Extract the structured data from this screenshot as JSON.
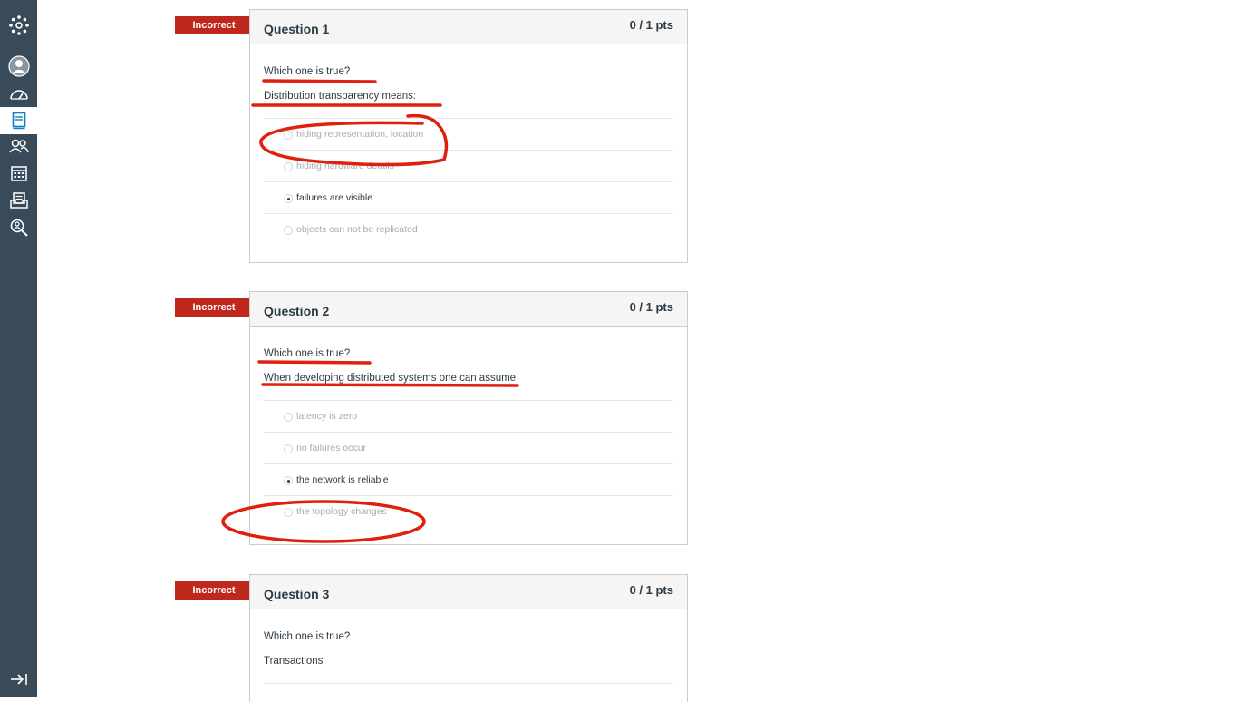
{
  "nav": {
    "items": [
      {
        "name": "canvas-logo-icon"
      },
      {
        "name": "account-icon"
      },
      {
        "name": "dashboard-icon"
      },
      {
        "name": "courses-icon"
      },
      {
        "name": "groups-icon"
      },
      {
        "name": "calendar-icon"
      },
      {
        "name": "inbox-icon"
      },
      {
        "name": "help-icon"
      }
    ],
    "collapse_icon": "collapse-icon"
  },
  "questions": [
    {
      "flag": "Incorrect",
      "title": "Question 1",
      "points": "0 / 1 pts",
      "prompt": "Which one is true?",
      "stem": "Distribution transparency means:",
      "answers": [
        {
          "label": "hiding representation, location",
          "selected": false
        },
        {
          "label": "hiding hardware details",
          "selected": false
        },
        {
          "label": "failures are visible",
          "selected": true
        },
        {
          "label": "objects can not be replicated",
          "selected": false
        }
      ]
    },
    {
      "flag": "Incorrect",
      "title": "Question 2",
      "points": "0 / 1 pts",
      "prompt": "Which one is true?",
      "stem": "When developing distributed systems one can assume",
      "answers": [
        {
          "label": "latency is zero",
          "selected": false
        },
        {
          "label": "no failures occur",
          "selected": false
        },
        {
          "label": "the network is reliable",
          "selected": true
        },
        {
          "label": "the topology changes",
          "selected": false
        }
      ]
    },
    {
      "flag": "Incorrect",
      "title": "Question 3",
      "points": "0 / 1 pts",
      "prompt": "Which one is true?",
      "stem": "Transactions",
      "answers": []
    }
  ],
  "colors": {
    "nav_bg": "#394b58",
    "flag_red": "#c0281e",
    "annotation_red": "#e0200f",
    "active_icon": "#0e7fc7"
  }
}
